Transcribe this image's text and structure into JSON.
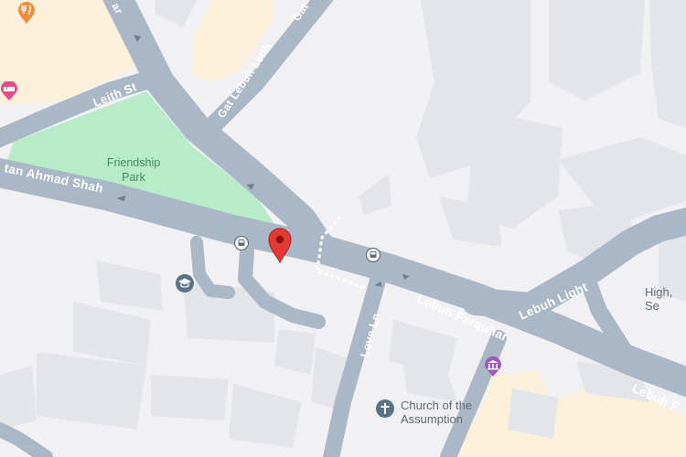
{
  "map": {
    "colors": {
      "background": "#f1f1f4",
      "building": "#e4e5ea",
      "road": "#aab7c6",
      "park": "#b8ecc8",
      "commercial": "#fdf0da",
      "pin": "#e53935",
      "poi_pink": "#e84a8a",
      "poi_orange": "#f08d3a",
      "poi_purple": "#9b59c7"
    },
    "streets": {
      "leith_st": "Leith St",
      "sultan_ahmad_shah": "tan Ahmad Shah",
      "gat_lebuh_leith": "Gat Lebuh Leith",
      "gat_top": "Gat",
      "top_left_partial": "ar",
      "lebuh_farquhar_mid": "Lebuh Farquhar",
      "lebuh_farquhar_right": "Lebuh F",
      "lebuh_light": "Lebuh Light",
      "love_ln": "Love Ln"
    },
    "places": {
      "park_line1": "Friendship",
      "park_line2": "Park",
      "church_line1": "Church of the",
      "church_line2": "Assumption",
      "high_partial": "High, Se"
    },
    "icons": {
      "restaurant": "restaurant-icon",
      "hotel": "hotel-icon",
      "bus_stop": "bus-stop-icon",
      "school": "school-icon",
      "museum": "museum-icon",
      "church": "church-icon",
      "pin": "location-pin-icon"
    }
  }
}
